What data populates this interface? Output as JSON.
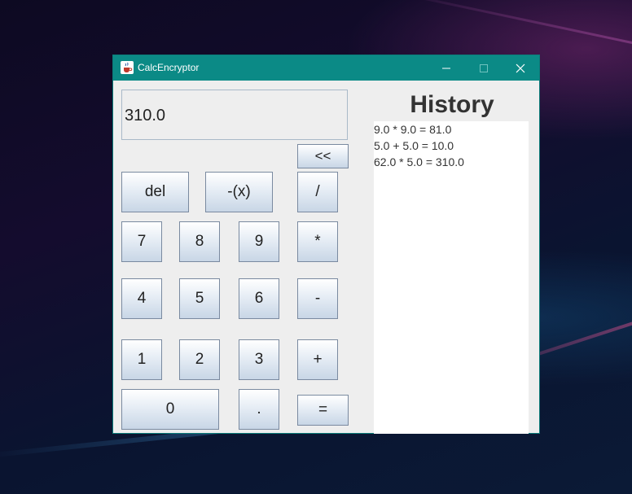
{
  "window": {
    "title": "CalcEncryptor",
    "title_color": "#0b8a86",
    "icon": "java-cup-icon",
    "controls": [
      "minimize-icon",
      "maximize-icon",
      "close-icon"
    ]
  },
  "display": {
    "value": "310.0"
  },
  "buttons": {
    "backspace": "<<",
    "del": "del",
    "negate": "-(x)",
    "divide": "/",
    "seven": "7",
    "eight": "8",
    "nine": "9",
    "multiply": "*",
    "four": "4",
    "five": "5",
    "six": "6",
    "minus": "-",
    "one": "1",
    "two": "2",
    "three": "3",
    "plus": "+",
    "zero": "0",
    "dot": ".",
    "equals": "="
  },
  "history": {
    "title": "History",
    "entries": [
      "9.0 * 9.0 = 81.0",
      "5.0 + 5.0 = 10.0",
      "62.0 * 5.0 = 310.0"
    ]
  }
}
